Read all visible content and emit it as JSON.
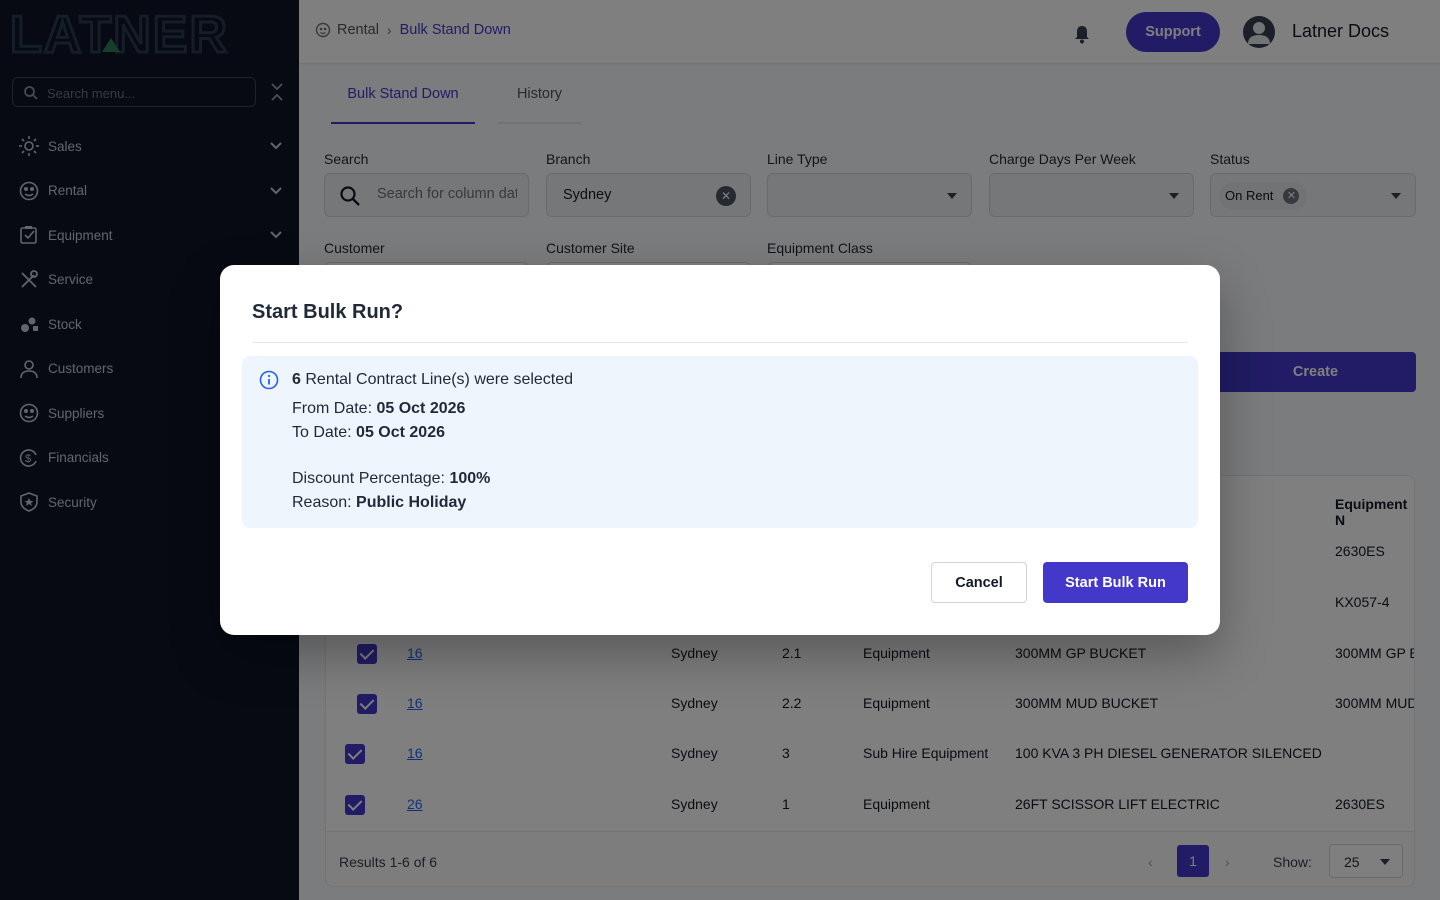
{
  "brand": {
    "logo_text": "LATNER",
    "primary": "#4338ca",
    "sidebar_bg": "#0e1527"
  },
  "sidebar": {
    "search_placeholder": "Search menu...",
    "items": [
      {
        "label": "Sales",
        "icon": "sales-icon",
        "expandable": true
      },
      {
        "label": "Rental",
        "icon": "rental-icon",
        "expandable": true
      },
      {
        "label": "Equipment",
        "icon": "equipment-icon",
        "expandable": true
      },
      {
        "label": "Service",
        "icon": "service-icon",
        "expandable": false
      },
      {
        "label": "Stock",
        "icon": "stock-icon",
        "expandable": false
      },
      {
        "label": "Customers",
        "icon": "customers-icon",
        "expandable": false
      },
      {
        "label": "Suppliers",
        "icon": "suppliers-icon",
        "expandable": false
      },
      {
        "label": "Financials",
        "icon": "financials-icon",
        "expandable": false
      },
      {
        "label": "Security",
        "icon": "security-icon",
        "expandable": false
      }
    ]
  },
  "header": {
    "breadcrumb": {
      "parent": "Rental",
      "current": "Bulk Stand Down"
    },
    "support_label": "Support",
    "user_name": "Latner Docs"
  },
  "tabs": [
    {
      "label": "Bulk Stand Down"
    },
    {
      "label": "History"
    }
  ],
  "filters": {
    "search": {
      "label": "Search",
      "placeholder": "Search for column data"
    },
    "branch": {
      "label": "Branch",
      "value": "Sydney"
    },
    "line_type": {
      "label": "Line Type",
      "value": ""
    },
    "charge_days": {
      "label": "Charge Days Per Week",
      "value": ""
    },
    "status": {
      "label": "Status",
      "chip": "On Rent"
    },
    "customer": {
      "label": "Customer"
    },
    "customer_site": {
      "label": "Customer Site"
    },
    "equipment_class": {
      "label": "Equipment Class"
    }
  },
  "create_label": "Create",
  "table": {
    "header_partial": "Equipment N",
    "rows": [
      {
        "contract": "",
        "branch": "",
        "line": "",
        "type": "",
        "description": "",
        "equipment": "2630ES",
        "checked": true
      },
      {
        "contract": "",
        "branch": "",
        "line": "",
        "type": "",
        "description": "",
        "equipment": "KX057-4",
        "checked": true
      },
      {
        "contract": "16",
        "branch": "Sydney",
        "line": "2.1",
        "type": "Equipment",
        "description": "300MM GP BUCKET",
        "equipment": "300MM GP B",
        "checked": true
      },
      {
        "contract": "16",
        "branch": "Sydney",
        "line": "2.2",
        "type": "Equipment",
        "description": "300MM MUD BUCKET",
        "equipment": "300MM MUD",
        "checked": true
      },
      {
        "contract": "16",
        "branch": "Sydney",
        "line": "3",
        "type": "Sub Hire Equipment",
        "description": "100 KVA 3 PH DIESEL GENERATOR SILENCED",
        "equipment": "",
        "checked": true
      },
      {
        "contract": "26",
        "branch": "Sydney",
        "line": "1",
        "type": "Equipment",
        "description": "26FT SCISSOR LIFT ELECTRIC",
        "equipment": "2630ES",
        "checked": true
      }
    ],
    "results_text": "Results 1-6 of 6",
    "current_page": "1",
    "show_label": "Show:",
    "page_size": "25"
  },
  "modal": {
    "title": "Start Bulk Run?",
    "count": "6",
    "selected_text": "Rental Contract Line(s) were selected",
    "from_label": "From Date:",
    "from_value": "05 Oct 2026",
    "to_label": "To Date:",
    "to_value": "05 Oct 2026",
    "discount_label": "Discount Percentage:",
    "discount_value": "100%",
    "reason_label": "Reason:",
    "reason_value": "Public Holiday",
    "cancel_label": "Cancel",
    "start_label": "Start Bulk Run"
  }
}
